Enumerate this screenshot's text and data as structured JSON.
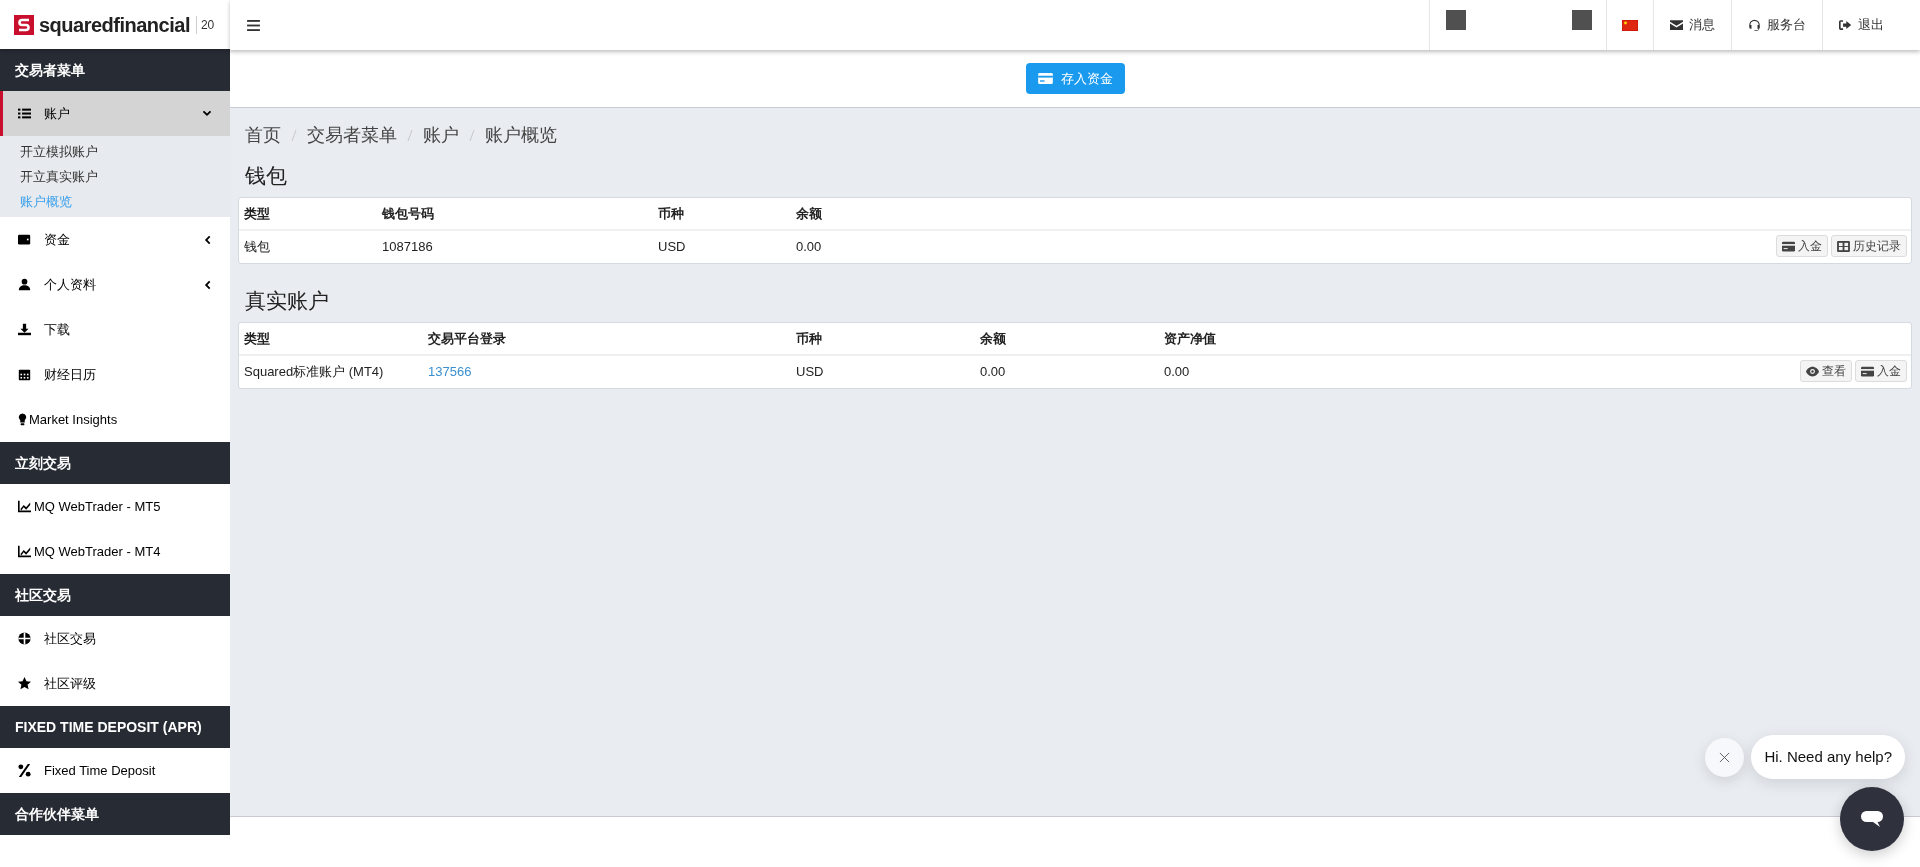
{
  "logo": {
    "brand": "squaredfinancial",
    "badge": "20"
  },
  "sidebar": {
    "sections": [
      {
        "title": "交易者菜单",
        "items": [
          {
            "label": "账户",
            "selected": true,
            "expanded": true,
            "children": [
              {
                "label": "开立模拟账户",
                "selected": false
              },
              {
                "label": "开立真实账户",
                "selected": false
              },
              {
                "label": "账户概览",
                "selected": true
              }
            ]
          },
          {
            "label": "资金",
            "selected": false,
            "expanded": false
          },
          {
            "label": "个人资料",
            "selected": false,
            "expanded": false
          },
          {
            "label": "下载",
            "selected": false
          },
          {
            "label": "财经日历",
            "selected": false
          },
          {
            "label": "Market Insights",
            "selected": false
          }
        ]
      },
      {
        "title": "立刻交易",
        "items": [
          {
            "label": "MQ WebTrader - MT5",
            "selected": false
          },
          {
            "label": "MQ WebTrader - MT4",
            "selected": false
          }
        ]
      },
      {
        "title": "社区交易",
        "items": [
          {
            "label": "社区交易",
            "selected": false
          },
          {
            "label": "社区评级",
            "selected": false
          }
        ]
      },
      {
        "title": "FIXED TIME DEPOSIT (APR)",
        "items": [
          {
            "label": "Fixed Time Deposit",
            "selected": false
          }
        ]
      },
      {
        "title": "合作伙伴菜单"
      }
    ]
  },
  "topbar": {
    "links": [
      {
        "kind": "mail",
        "label": "消息"
      },
      {
        "kind": "support",
        "label": "服务台"
      },
      {
        "kind": "logout",
        "label": "退出"
      }
    ]
  },
  "deposit_button": "存入资金",
  "breadcrumb": [
    "首页",
    "交易者菜单",
    "账户",
    "账户概览"
  ],
  "tables": [
    {
      "title": "钱包",
      "columns": [
        "类型",
        "钱包号码",
        "币种",
        "余额"
      ],
      "rows": [
        {
          "cells": [
            {
              "kind": "text",
              "text": "钱包"
            },
            {
              "kind": "text",
              "text": "1087186"
            },
            {
              "kind": "text",
              "text": "USD"
            },
            {
              "kind": "text",
              "text": "0.00"
            }
          ],
          "actions": [
            {
              "kind": "deposit",
              "label": "入金"
            },
            {
              "kind": "history",
              "label": "历史记录"
            }
          ]
        }
      ]
    },
    {
      "title": "真实账户",
      "columns": [
        "类型",
        "交易平台登录",
        "币种",
        "余额",
        "资产净值"
      ],
      "rows": [
        {
          "cells": [
            {
              "kind": "text",
              "text": "Squared标准账户 (MT4)"
            },
            {
              "kind": "link",
              "text": "137566"
            },
            {
              "kind": "text",
              "text": "USD"
            },
            {
              "kind": "text",
              "text": "0.00"
            },
            {
              "kind": "text",
              "text": "0.00"
            }
          ],
          "actions": [
            {
              "kind": "view",
              "label": "查看"
            },
            {
              "kind": "deposit",
              "label": "入金"
            }
          ]
        }
      ]
    }
  ],
  "chat": {
    "greeting": "Hi. Need any help?"
  }
}
